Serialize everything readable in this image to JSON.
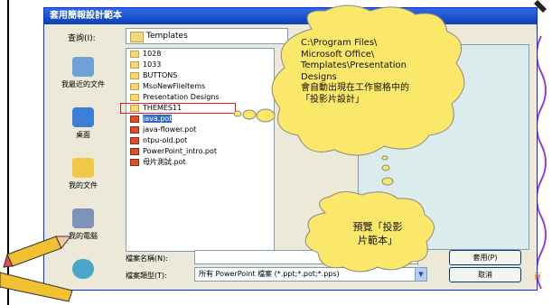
{
  "dialog": {
    "title": "套用簡報設計範本",
    "look_in_label": "查詢(I):",
    "look_in_value": "Templates",
    "places": [
      {
        "label": "我最近的文件",
        "icon": "recent-documents-icon"
      },
      {
        "label": "桌面",
        "icon": "desktop-icon"
      },
      {
        "label": "我的文件",
        "icon": "my-documents-icon"
      },
      {
        "label": "我的電腦",
        "icon": "my-computer-icon"
      },
      {
        "label": "",
        "icon": "network-places-icon"
      }
    ],
    "files": [
      {
        "name": "1028",
        "type": "folder"
      },
      {
        "name": "1033",
        "type": "folder"
      },
      {
        "name": "BUTTONS",
        "type": "folder"
      },
      {
        "name": "MsoNewFileItems",
        "type": "folder"
      },
      {
        "name": "Presentation Designs",
        "type": "folder"
      },
      {
        "name": "THEMES11",
        "type": "folder"
      },
      {
        "name": "java.pot",
        "type": "ppt",
        "selected": true
      },
      {
        "name": "java-flower.pot",
        "type": "ppt"
      },
      {
        "name": "ntpu-old.pot",
        "type": "ppt"
      },
      {
        "name": "PowerPoint_intro.pot",
        "type": "ppt"
      },
      {
        "name": "母片測試.pot",
        "type": "ppt"
      }
    ],
    "filename_label": "檔案名稱(N):",
    "filename_value": "",
    "filetype_label": "檔案類型(T):",
    "filetype_value": "所有 PowerPoint 檔案 (*.ppt;*.pot;*.pps)",
    "apply_button": "套用(P)",
    "cancel_button": "取消"
  },
  "callout_top": {
    "lines": [
      "C:\\Program Files\\",
      "Microsoft Office\\",
      "Templates\\Presentation",
      "Designs",
      "會自動出現在工作窗格中的",
      "「投影片設計」"
    ]
  },
  "callout_bottom": {
    "lines": [
      "預覽「投影",
      "片範本」"
    ]
  },
  "page_label": "頁",
  "colors": {
    "accent": "#316ac5",
    "title_bar": "#0a3fb8",
    "cloud": "#fbe76a",
    "highlight": "#e02020"
  }
}
